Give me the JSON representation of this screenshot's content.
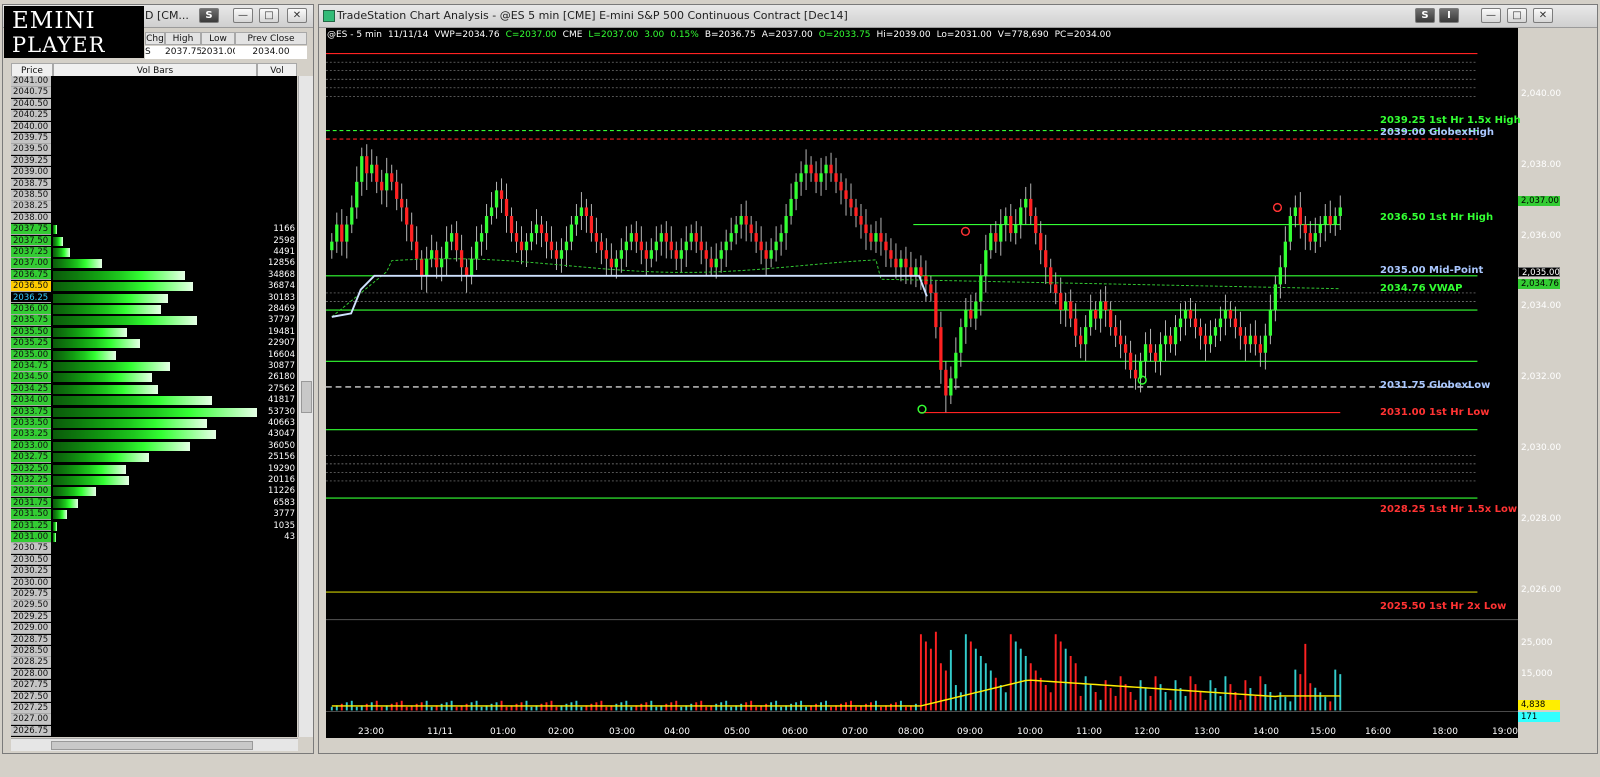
{
  "logo": {
    "line1": "EMINI",
    "line2": "PLAYER"
  },
  "left_window": {
    "title": "D [CM...",
    "s_button": "S",
    "quote_headers": [
      "Chg",
      "High",
      "Low",
      "Prev Close"
    ],
    "quote_values": [
      "2037.75",
      "2031.00",
      "2034.00"
    ],
    "quote_tail": "S",
    "column_headers": {
      "price": "Price",
      "bars": "Vol Bars",
      "vol": "Vol"
    },
    "rows": [
      {
        "price": "2041.00",
        "vol": ""
      },
      {
        "price": "2040.75",
        "vol": ""
      },
      {
        "price": "2040.50",
        "vol": ""
      },
      {
        "price": "2040.25",
        "vol": ""
      },
      {
        "price": "2040.00",
        "vol": ""
      },
      {
        "price": "2039.75",
        "vol": ""
      },
      {
        "price": "2039.50",
        "vol": ""
      },
      {
        "price": "2039.25",
        "vol": ""
      },
      {
        "price": "2039.00",
        "vol": ""
      },
      {
        "price": "2038.75",
        "vol": ""
      },
      {
        "price": "2038.50",
        "vol": ""
      },
      {
        "price": "2038.25",
        "vol": ""
      },
      {
        "price": "2038.00",
        "vol": ""
      },
      {
        "price": "2037.75",
        "vol": "1166"
      },
      {
        "price": "2037.50",
        "vol": "2598"
      },
      {
        "price": "2037.25",
        "vol": "4491"
      },
      {
        "price": "2037.00",
        "vol": "12856"
      },
      {
        "price": "2036.75",
        "vol": "34868"
      },
      {
        "price": "2036.50",
        "vol": "36874"
      },
      {
        "price": "2036.25",
        "vol": "30183"
      },
      {
        "price": "2036.00",
        "vol": "28469"
      },
      {
        "price": "2035.75",
        "vol": "37797"
      },
      {
        "price": "2035.50",
        "vol": "19481"
      },
      {
        "price": "2035.25",
        "vol": "22907"
      },
      {
        "price": "2035.00",
        "vol": "16604"
      },
      {
        "price": "2034.75",
        "vol": "30877"
      },
      {
        "price": "2034.50",
        "vol": "26180"
      },
      {
        "price": "2034.25",
        "vol": "27562"
      },
      {
        "price": "2034.00",
        "vol": "41817"
      },
      {
        "price": "2033.75",
        "vol": "53730"
      },
      {
        "price": "2033.50",
        "vol": "40663"
      },
      {
        "price": "2033.25",
        "vol": "43047"
      },
      {
        "price": "2033.00",
        "vol": "36050"
      },
      {
        "price": "2032.75",
        "vol": "25156"
      },
      {
        "price": "2032.50",
        "vol": "19290"
      },
      {
        "price": "2032.25",
        "vol": "20116"
      },
      {
        "price": "2032.00",
        "vol": "11226"
      },
      {
        "price": "2031.75",
        "vol": "6583"
      },
      {
        "price": "2031.50",
        "vol": "3777"
      },
      {
        "price": "2031.25",
        "vol": "1035"
      },
      {
        "price": "2031.00",
        "vol": "43"
      },
      {
        "price": "2030.75",
        "vol": ""
      },
      {
        "price": "2030.50",
        "vol": ""
      },
      {
        "price": "2030.25",
        "vol": ""
      },
      {
        "price": "2030.00",
        "vol": ""
      },
      {
        "price": "2029.75",
        "vol": ""
      },
      {
        "price": "2029.50",
        "vol": ""
      },
      {
        "price": "2029.25",
        "vol": ""
      },
      {
        "price": "2029.00",
        "vol": ""
      },
      {
        "price": "2028.75",
        "vol": ""
      },
      {
        "price": "2028.50",
        "vol": ""
      },
      {
        "price": "2028.25",
        "vol": ""
      },
      {
        "price": "2028.00",
        "vol": ""
      },
      {
        "price": "2027.75",
        "vol": ""
      },
      {
        "price": "2027.50",
        "vol": ""
      },
      {
        "price": "2027.25",
        "vol": ""
      },
      {
        "price": "2027.00",
        "vol": ""
      },
      {
        "price": "2026.75",
        "vol": ""
      }
    ],
    "highlight_price": "2036.50",
    "current_price": "2036.25",
    "max_vol": 53730
  },
  "chart_window": {
    "title": "TradeStation Chart Analysis - @ES 5 min [CME] E-mini S&P 500 Continuous Contract [Dec14]",
    "s_button": "S",
    "i_button": "I",
    "info": [
      {
        "text": "@ES - 5 min",
        "color": "#ffffff"
      },
      {
        "text": "11/11/14",
        "color": "#ffffff"
      },
      {
        "text": "VWP=2034.76",
        "color": "#ffffff"
      },
      {
        "text": "C=2037.00",
        "color": "#33ff33"
      },
      {
        "text": "CME",
        "color": "#ffffff"
      },
      {
        "text": "L=2037.00",
        "color": "#33ff33"
      },
      {
        "text": "3.00",
        "color": "#33ff33"
      },
      {
        "text": "0.15%",
        "color": "#33ff33"
      },
      {
        "text": "B=2036.75",
        "color": "#ffffff"
      },
      {
        "text": "A=2037.00",
        "color": "#ffffff"
      },
      {
        "text": "O=2033.75",
        "color": "#33ff33"
      },
      {
        "text": "Hi=2039.00",
        "color": "#ffffff"
      },
      {
        "text": "Lo=2031.00",
        "color": "#ffffff"
      },
      {
        "text": "V=778,690",
        "color": "#ffffff"
      },
      {
        "text": "PC=2034.00",
        "color": "#ffffff"
      }
    ],
    "price_axis": [
      "2,040.00",
      "2,038.00",
      "2,036.00",
      "2,034.00",
      "2,032.00",
      "2,030.00",
      "2,028.00",
      "2,026.00"
    ],
    "volume_axis": [
      "25,000",
      "15,000"
    ],
    "time_axis": [
      "23:00",
      "11/11",
      "01:00",
      "02:00",
      "03:00",
      "04:00",
      "05:00",
      "06:00",
      "07:00",
      "08:00",
      "09:00",
      "10:00",
      "11:00",
      "12:00",
      "13:00",
      "14:00",
      "15:00",
      "16:00",
      "18:00",
      "19:00"
    ],
    "levels": [
      {
        "label": "2039.25 1st Hr  1.5x High",
        "color": "#33ff33"
      },
      {
        "label": "2039.00 GlobexHigh",
        "color": "#aac8ff"
      },
      {
        "label": "2036.50 1st Hr  High",
        "color": "#33ff33"
      },
      {
        "label": "2035.00 Mid-Point",
        "color": "#aac8ff"
      },
      {
        "label": "2034.76 VWAP",
        "color": "#33ff33"
      },
      {
        "label": "2031.75 GlobexLow",
        "color": "#aac8ff"
      },
      {
        "label": "2031.00 1st Hr  Low",
        "color": "#ff3333"
      },
      {
        "label": "2028.25 1st Hr  1.5x Low",
        "color": "#ff3333"
      },
      {
        "label": "2025.50 1st Hr  2x Low",
        "color": "#ff3333"
      }
    ],
    "price_tags": [
      {
        "text": "2,037.00",
        "color": "#33cc33"
      },
      {
        "text": "2,035.00",
        "color": "#000000"
      },
      {
        "text": "2,034.76",
        "color": "#33cc33"
      },
      {
        "text": "4,838",
        "color": "#ffee00"
      },
      {
        "text": "171",
        "color": "#33ffff"
      }
    ],
    "colors": {
      "up": "#33ff33",
      "down": "#ff2222",
      "vwap": "#33cc33",
      "volume_up": "#33cccc",
      "volume_down": "#ff2222",
      "volume_avg": "#ffee00"
    }
  },
  "chart_data": {
    "type": "candlestick",
    "symbol": "@ES",
    "interval": "5 min",
    "date": "11/11/14",
    "ylim": [
      2025.0,
      2041.5
    ],
    "x": [
      "22:30",
      "22:35",
      "22:40",
      "22:45",
      "22:50",
      "22:55",
      "23:00",
      "23:05",
      "23:10",
      "23:15",
      "23:20",
      "23:25",
      "23:30",
      "23:35",
      "23:40",
      "23:45",
      "23:50",
      "23:55",
      "00:00",
      "00:05",
      "00:10",
      "00:15",
      "00:20",
      "00:25",
      "00:30",
      "00:35",
      "00:40",
      "00:45",
      "00:50",
      "00:55",
      "01:00",
      "01:05",
      "01:10",
      "01:15",
      "01:20",
      "01:25",
      "01:30",
      "01:35",
      "01:40",
      "01:45",
      "01:50",
      "01:55",
      "02:00",
      "02:05",
      "02:10",
      "02:15",
      "02:20",
      "02:25",
      "02:30",
      "02:35",
      "02:40",
      "02:45",
      "02:50",
      "02:55",
      "03:00",
      "03:05",
      "03:10",
      "03:15",
      "03:20",
      "03:25",
      "03:30",
      "03:35",
      "03:40",
      "03:45",
      "03:50",
      "03:55",
      "04:00",
      "04:05",
      "04:10",
      "04:15",
      "04:20",
      "04:25",
      "04:30",
      "04:35",
      "04:40",
      "04:45",
      "04:50",
      "04:55",
      "05:00",
      "05:05",
      "05:10",
      "05:15",
      "05:20",
      "05:25",
      "05:30",
      "05:35",
      "05:40",
      "05:45",
      "05:50",
      "05:55",
      "06:00",
      "06:05",
      "06:10",
      "06:15",
      "06:20",
      "06:25",
      "06:30",
      "06:35",
      "06:40",
      "06:45",
      "06:50",
      "06:55",
      "07:00",
      "07:05",
      "07:10",
      "07:15",
      "07:20",
      "07:25",
      "07:30",
      "07:35",
      "07:40",
      "07:45",
      "07:50",
      "07:55",
      "08:00",
      "08:05",
      "08:10",
      "08:15",
      "08:20",
      "08:25",
      "08:30",
      "08:35",
      "08:40",
      "08:45",
      "08:50",
      "08:55",
      "09:00",
      "09:05",
      "09:10",
      "09:15",
      "09:20",
      "09:25",
      "09:30",
      "09:35",
      "09:40",
      "09:45",
      "09:50",
      "09:55",
      "10:00",
      "10:05",
      "10:10",
      "10:15",
      "10:20",
      "10:25",
      "10:30",
      "10:35",
      "10:40",
      "10:45",
      "10:50",
      "10:55",
      "11:00",
      "11:05",
      "11:10",
      "11:15",
      "11:20",
      "11:25",
      "11:30",
      "11:35",
      "11:40",
      "11:45",
      "11:50",
      "11:55",
      "12:00",
      "12:05",
      "12:10",
      "12:15",
      "12:20",
      "12:25",
      "12:30",
      "12:35",
      "12:40",
      "12:45",
      "12:50",
      "12:55",
      "13:00",
      "13:05",
      "13:10",
      "13:15",
      "13:20",
      "13:25",
      "13:30",
      "13:35",
      "13:40",
      "13:45",
      "13:50",
      "13:55",
      "14:00",
      "14:05",
      "14:10",
      "14:15",
      "14:20",
      "14:25",
      "14:30",
      "14:35",
      "14:40",
      "14:45",
      "14:50",
      "14:55",
      "15:00",
      "15:05",
      "15:10",
      "15:15",
      "15:20",
      "15:25",
      "15:30",
      "15:35",
      "15:40",
      "15:45",
      "15:50",
      "15:55",
      "16:00",
      "16:05",
      "16:10",
      "16:15"
    ],
    "close": [
      2036.0,
      2036.5,
      2036.0,
      2036.5,
      2037.0,
      2037.75,
      2038.5,
      2038.0,
      2038.25,
      2037.75,
      2037.5,
      2038.0,
      2037.75,
      2037.25,
      2037.0,
      2036.5,
      2036.0,
      2035.5,
      2035.0,
      2035.5,
      2035.75,
      2035.25,
      2035.5,
      2036.0,
      2036.25,
      2035.75,
      2035.25,
      2035.0,
      2035.5,
      2036.0,
      2036.25,
      2036.75,
      2037.0,
      2037.5,
      2037.25,
      2036.75,
      2036.25,
      2036.0,
      2035.75,
      2036.0,
      2036.25,
      2036.5,
      2036.25,
      2036.0,
      2035.75,
      2035.5,
      2035.75,
      2036.0,
      2036.5,
      2036.75,
      2037.0,
      2036.75,
      2036.25,
      2036.0,
      2035.75,
      2035.5,
      2035.25,
      2035.5,
      2035.75,
      2036.0,
      2036.25,
      2036.0,
      2035.75,
      2035.5,
      2035.75,
      2036.0,
      2036.25,
      2036.0,
      2035.75,
      2035.5,
      2035.75,
      2036.0,
      2036.25,
      2036.0,
      2035.75,
      2035.5,
      2035.25,
      2035.5,
      2035.75,
      2036.0,
      2036.25,
      2036.5,
      2036.75,
      2036.5,
      2036.25,
      2036.0,
      2035.75,
      2035.5,
      2035.75,
      2036.0,
      2036.25,
      2036.75,
      2037.25,
      2037.75,
      2038.0,
      2038.25,
      2038.0,
      2037.75,
      2038.0,
      2038.25,
      2038.0,
      2037.75,
      2037.5,
      2037.25,
      2037.0,
      2036.75,
      2036.5,
      2036.25,
      2036.0,
      2036.25,
      2036.0,
      2035.75,
      2035.5,
      2035.25,
      2035.5,
      2035.25,
      2035.0,
      2035.25,
      2035.0,
      2034.75,
      2034.5,
      2033.5,
      2032.25,
      2031.5,
      2032.0,
      2032.75,
      2033.5,
      2034.0,
      2033.75,
      2034.25,
      2035.0,
      2035.75,
      2036.25,
      2036.0,
      2036.5,
      2036.75,
      2036.25,
      2036.5,
      2037.0,
      2037.25,
      2036.75,
      2036.25,
      2035.75,
      2035.25,
      2034.75,
      2034.5,
      2034.0,
      2034.25,
      2033.75,
      2033.25,
      2033.0,
      2033.5,
      2034.0,
      2033.75,
      2034.25,
      2034.0,
      2033.5,
      2033.25,
      2033.0,
      2032.75,
      2032.25,
      2032.0,
      2032.5,
      2033.0,
      2032.75,
      2032.5,
      2033.0,
      2033.25,
      2033.0,
      2033.5,
      2033.75,
      2034.0,
      2033.75,
      2033.5,
      2033.25,
      2033.0,
      2033.25,
      2033.5,
      2033.75,
      2034.0,
      2033.75,
      2033.5,
      2033.25,
      2033.0,
      2033.25,
      2033.0,
      2032.75,
      2033.25,
      2034.0,
      2034.75,
      2035.25,
      2036.0,
      2036.75,
      2037.0,
      2036.5,
      2036.25,
      2036.0,
      2036.25,
      2036.5,
      2036.75,
      2036.5,
      2036.75,
      2037.0
    ],
    "vwap": 2034.76,
    "levels": [
      2039.25,
      2039.0,
      2036.5,
      2035.0,
      2034.76,
      2031.75,
      2031.0,
      2028.25,
      2025.5
    ],
    "volume_ylim": [
      0,
      30000
    ]
  }
}
